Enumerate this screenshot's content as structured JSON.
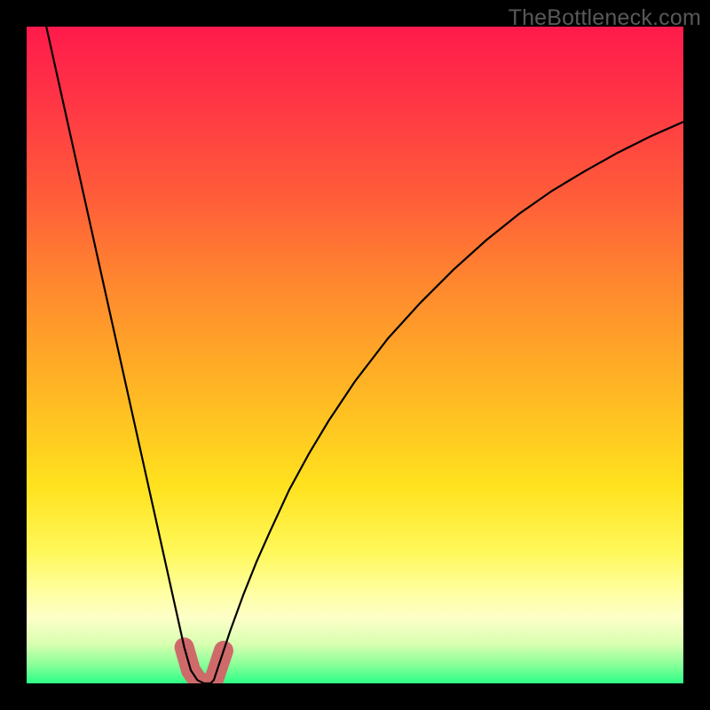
{
  "watermark": "TheBottleneck.com",
  "chart_data": {
    "type": "line",
    "title": "",
    "xlabel": "",
    "ylabel": "",
    "xlim": [
      0,
      100
    ],
    "ylim": [
      0,
      100
    ],
    "x": [
      3,
      5,
      7,
      9,
      11,
      13,
      15,
      17,
      19,
      21,
      22,
      23,
      24,
      25,
      26,
      27,
      27.5,
      28,
      28.5,
      29,
      30,
      31,
      33,
      35,
      37,
      40,
      43,
      46,
      50,
      55,
      60,
      65,
      70,
      75,
      80,
      85,
      90,
      95,
      100
    ],
    "values": [
      100,
      91,
      82,
      73,
      64,
      55,
      46,
      37,
      28,
      19,
      14.5,
      10,
      5.5,
      2,
      0.5,
      0,
      0,
      0,
      0.5,
      2,
      5,
      8,
      13.5,
      18.5,
      23,
      29.5,
      35,
      40,
      46,
      52.5,
      58,
      63,
      67.5,
      71.5,
      75,
      78,
      80.8,
      83.3,
      85.5
    ],
    "highlight_region_x": [
      23.5,
      30
    ],
    "gradient_stops": [
      {
        "pos": 0.0,
        "color": "#ff1a4b"
      },
      {
        "pos": 0.1,
        "color": "#ff3246"
      },
      {
        "pos": 0.25,
        "color": "#ff5a3a"
      },
      {
        "pos": 0.4,
        "color": "#ff8a2e"
      },
      {
        "pos": 0.55,
        "color": "#ffb524"
      },
      {
        "pos": 0.7,
        "color": "#ffe21e"
      },
      {
        "pos": 0.8,
        "color": "#fff85a"
      },
      {
        "pos": 0.86,
        "color": "#ffffa0"
      },
      {
        "pos": 0.9,
        "color": "#fdffc8"
      },
      {
        "pos": 0.94,
        "color": "#d8ffb0"
      },
      {
        "pos": 0.97,
        "color": "#8dff9a"
      },
      {
        "pos": 1.0,
        "color": "#2dff86"
      }
    ],
    "highlight_color": "#cf6a6a",
    "curve_color": "#000000"
  }
}
